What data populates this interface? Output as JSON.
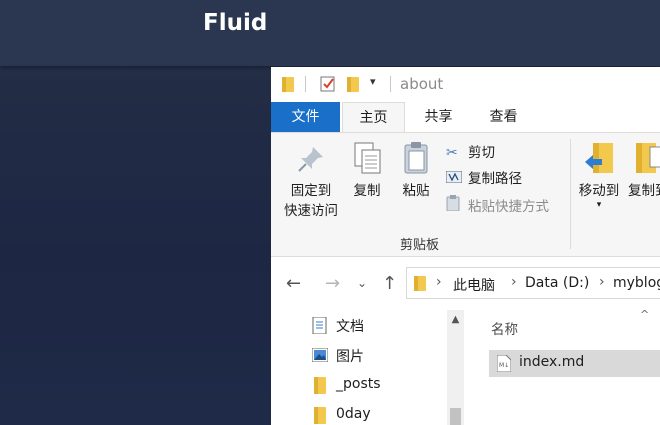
{
  "site": {
    "title": "Fluid"
  },
  "explorer": {
    "window_title": "about",
    "tabs": {
      "file": "文件",
      "home": "主页",
      "share": "共享",
      "view": "查看"
    },
    "ribbon": {
      "pin_quick_access": [
        "固定到",
        "快速访问"
      ],
      "copy": "复制",
      "paste": "粘贴",
      "cut": "剪切",
      "copy_path": "复制路径",
      "paste_shortcut": "粘贴快捷方式",
      "clipboard_group": "剪贴板",
      "move_to": "移动到",
      "copy_to": "复制到"
    },
    "address": {
      "crumbs": [
        "此电脑",
        "Data (D:)",
        "myblog"
      ]
    },
    "nav_pane": {
      "items": [
        {
          "label": "文档",
          "icon": "documents-icon",
          "pinned": true
        },
        {
          "label": "图片",
          "icon": "pictures-icon",
          "pinned": true
        },
        {
          "label": "_posts",
          "icon": "folder-icon",
          "pinned": false
        },
        {
          "label": "0day",
          "icon": "folder-icon",
          "pinned": false
        }
      ]
    },
    "file_pane": {
      "column_name": "名称",
      "files": [
        {
          "name": "index.md",
          "icon": "markdown-file-icon",
          "selected": true
        }
      ]
    },
    "colors": {
      "file_tab": "#1a6fc8",
      "folder": "#f2c94c",
      "selection": "#d9d9d9"
    }
  }
}
